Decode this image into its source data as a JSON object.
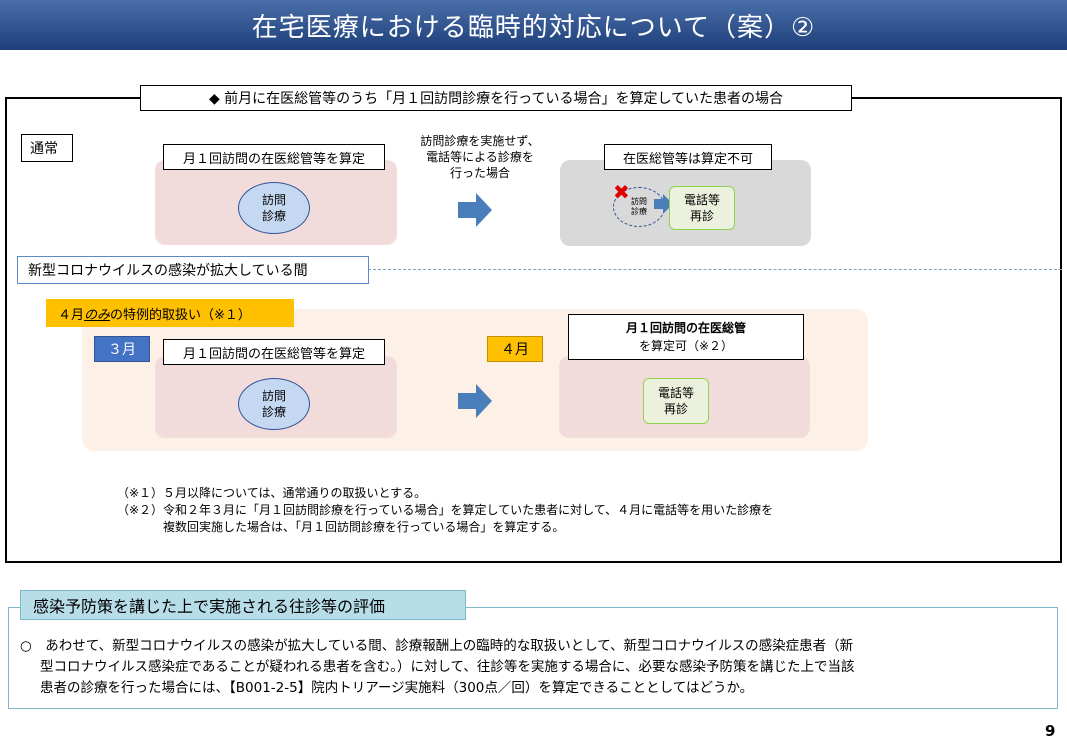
{
  "header": {
    "title": "在宅医療における臨時的対応について（案）②"
  },
  "frame": {
    "label": "◆ 前月に在医総管等のうち「月１回訪問診療を行っている場合」を算定していた患者の場合"
  },
  "normal": {
    "tag": "通常",
    "left_box_label": "月１回訪問の在医総管等を算定",
    "left_ellipse": [
      "訪問",
      "診療"
    ],
    "arrow_caption": [
      "訪問診療を実施せず、",
      "電話等による診療を",
      "行った場合"
    ],
    "right_box_label": "在医総管等は算定不可",
    "right_small_ellipse": [
      "訪問",
      "診療"
    ],
    "right_green": [
      "電話等",
      "再診"
    ]
  },
  "covid_section": {
    "label": "新型コロナウイルスの感染が拡大している間"
  },
  "special": {
    "tag_prefix": "４月",
    "tag_underlined": "のみ",
    "tag_suffix": "の特例的取扱い（※１）",
    "march": "３月",
    "april": "４月",
    "left_box_label": "月１回訪問の在医総管等を算定",
    "left_ellipse": [
      "訪問",
      "診療"
    ],
    "right_box_title": "月１回訪問の在医総管",
    "right_box_sub": "を算定可（※２）",
    "right_green": [
      "電話等",
      "再診"
    ]
  },
  "notes": {
    "n1": "（※１）５月以降については、通常通りの取扱いとする。",
    "n2a": "（※２）令和２年３月に「月１回訪問診療を行っている場合」を算定していた患者に対して、４月に電話等を用いた診療を",
    "n2b": "複数回実施した場合は、「月１回訪問診療を行っている場合」を算定する。"
  },
  "evaluation": {
    "title": "感染予防策を講じた上で実施される往診等の評価",
    "line1": "○　あわせて、新型コロナウイルスの感染が拡大している間、診療報酬上の臨時的な取扱いとして、新型コロナウイルスの感染症患者（新",
    "line2": "型コロナウイルス感染症であることが疑われる患者を含む。）に対して、往診等を実施する場合に、必要な感染予防策を講じた上で当該",
    "line3": "患者の診療を行った場合には、【B001-2-5】院内トリアージ実施料（300点／回）を算定できることとしてはどうか。"
  },
  "page_number": "9",
  "colors": {
    "title_bar": "#1e3f7a",
    "pink": "#f2dcdb",
    "special_bg": "#fdf0e6",
    "orange": "#ffc000",
    "blue_tag": "#4472c4",
    "arrow": "#4a7ebb",
    "eval_border": "#7fb6c9"
  }
}
